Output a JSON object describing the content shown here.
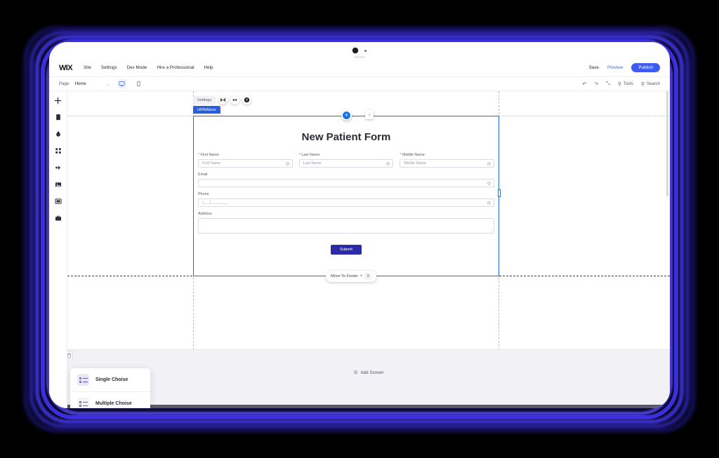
{
  "app": {
    "brand": "WIX",
    "menu": [
      "Site",
      "Settings",
      "Dev Mode",
      "Hire a Professional",
      "Help"
    ],
    "save_label": "Save",
    "preview_label": "Preview",
    "publish_label": "Publish"
  },
  "toolbar": {
    "page_label": "Page:",
    "page_value": "Home",
    "chevron": "⌄",
    "desktop_icon": "desktop-icon",
    "mobile_icon": "mobile-icon",
    "undo_icon": "↶",
    "redo_icon": "↷",
    "fit_icon": "⤡",
    "tools_label": "Tools",
    "search_label": "Search",
    "search_icon": "⚲"
  },
  "sidebar": {
    "items": [
      {
        "name": "add-element",
        "icon": "plus-icon"
      },
      {
        "name": "pages",
        "icon": "page-icon"
      },
      {
        "name": "site-design",
        "icon": "paint-icon"
      },
      {
        "name": "apps",
        "icon": "apps-grid-icon"
      },
      {
        "name": "media",
        "icon": "media-icon"
      },
      {
        "name": "my-uploads",
        "icon": "image-icon"
      },
      {
        "name": "blog",
        "icon": "blog-icon"
      },
      {
        "name": "business-tools",
        "icon": "briefcase-icon"
      }
    ],
    "trash_icon": "trash-icon"
  },
  "selection": {
    "settings_label": "Settings",
    "stretch_icon": "stretch-icon",
    "resize_icon": "↔",
    "help_icon": "?",
    "app_tag": "HIPAAtizer",
    "plus_handle": "+",
    "drag_handle": "↕",
    "move_to_footer_label": "Move To Footer",
    "move_to_footer_plus": "+",
    "move_to_footer_grip": "≡"
  },
  "form": {
    "title": "New Patient Form",
    "fields": [
      {
        "label": "First Name",
        "placeholder": "First Name",
        "required": true,
        "type": "text"
      },
      {
        "label": "Last Name",
        "placeholder": "Last Name",
        "required": true,
        "type": "text"
      },
      {
        "label": "Middle Name",
        "placeholder": "Middle Name",
        "required": true,
        "type": "text"
      },
      {
        "label": "Email",
        "placeholder": "",
        "required": false,
        "type": "text"
      },
      {
        "label": "Phone",
        "placeholder": "(___) ___-____",
        "required": false,
        "type": "text"
      },
      {
        "label": "Address",
        "placeholder": "",
        "required": false,
        "type": "textarea"
      }
    ],
    "submit_label": "Submit"
  },
  "bottom": {
    "add_screen_label": "Add Screen",
    "add_screen_icon": "⊞",
    "choices": [
      {
        "label": "Single Choise",
        "icon": "radio-list-icon"
      },
      {
        "label": "Multiple Choise",
        "icon": "checkbox-list-icon"
      }
    ]
  },
  "colors": {
    "glow": "#3b30d9",
    "publish": "#3e5cf0",
    "selection": "#1f6fe0",
    "app_tag": "#2b5fd9",
    "submit": "#2b2baa",
    "required": "#e04747"
  }
}
